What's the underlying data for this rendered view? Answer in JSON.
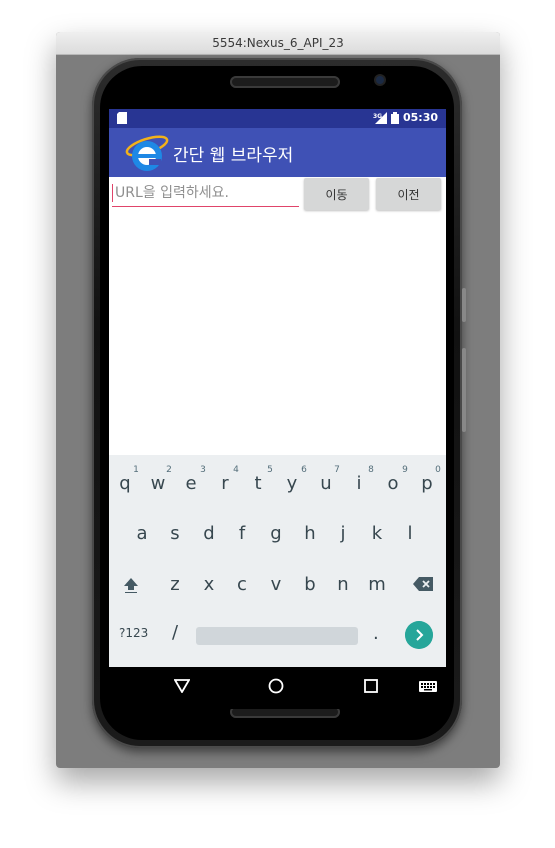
{
  "emulator": {
    "title": "5554:Nexus_6_API_23"
  },
  "status_bar": {
    "time": "05:30",
    "network": "3G"
  },
  "app_bar": {
    "title": "간단 웹 브라우저"
  },
  "url_bar": {
    "placeholder": "URL을 입력하세요.",
    "value": ""
  },
  "buttons": {
    "go": "이동",
    "back": "이전"
  },
  "keyboard": {
    "row1": [
      "q",
      "w",
      "e",
      "r",
      "t",
      "y",
      "u",
      "i",
      "o",
      "p"
    ],
    "row1_hints": [
      "1",
      "2",
      "3",
      "4",
      "5",
      "6",
      "7",
      "8",
      "9",
      "0"
    ],
    "row2": [
      "a",
      "s",
      "d",
      "f",
      "g",
      "h",
      "j",
      "k",
      "l"
    ],
    "row3": [
      "z",
      "x",
      "c",
      "v",
      "b",
      "n",
      "m"
    ],
    "symbols_key": "?123",
    "slash_key": "/",
    "period_key": "."
  },
  "colors": {
    "status_bar": "#283593",
    "app_bar": "#3f51b5",
    "accent": "#e0446a",
    "enter_key": "#26a69a",
    "keyboard_bg": "#eceff1"
  },
  "icons": {
    "status": [
      "sd-card-icon",
      "signal-icon",
      "battery-icon"
    ],
    "app": "internet-explorer-logo-icon",
    "keyboard": [
      "shift-icon",
      "delete-icon",
      "enter-arrow-icon"
    ],
    "nav": [
      "back-icon",
      "home-icon",
      "recents-icon",
      "keyboard-switch-icon"
    ]
  }
}
